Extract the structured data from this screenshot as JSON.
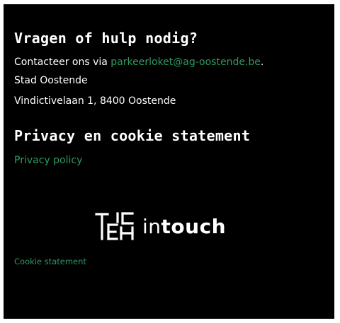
{
  "help": {
    "title": "Vragen of hulp nodig?",
    "contact_prefix": "Contacteer ons via ",
    "contact_email": "parkeerloket@ag-oostende.be",
    "contact_suffix": ".",
    "org_name": "Stad Oostende",
    "address": "Vindictivelaan 1, 8400 Oostende"
  },
  "privacy": {
    "title": "Privacy en cookie statement",
    "policy_link": "Privacy policy",
    "cookie_link": "Cookie statement"
  },
  "logo": {
    "text_light": "in",
    "text_bold": "touch",
    "icon": "tech-monogram-icon"
  },
  "colors": {
    "background": "#000000",
    "text": "#ffffff",
    "link": "#2f9a62"
  }
}
